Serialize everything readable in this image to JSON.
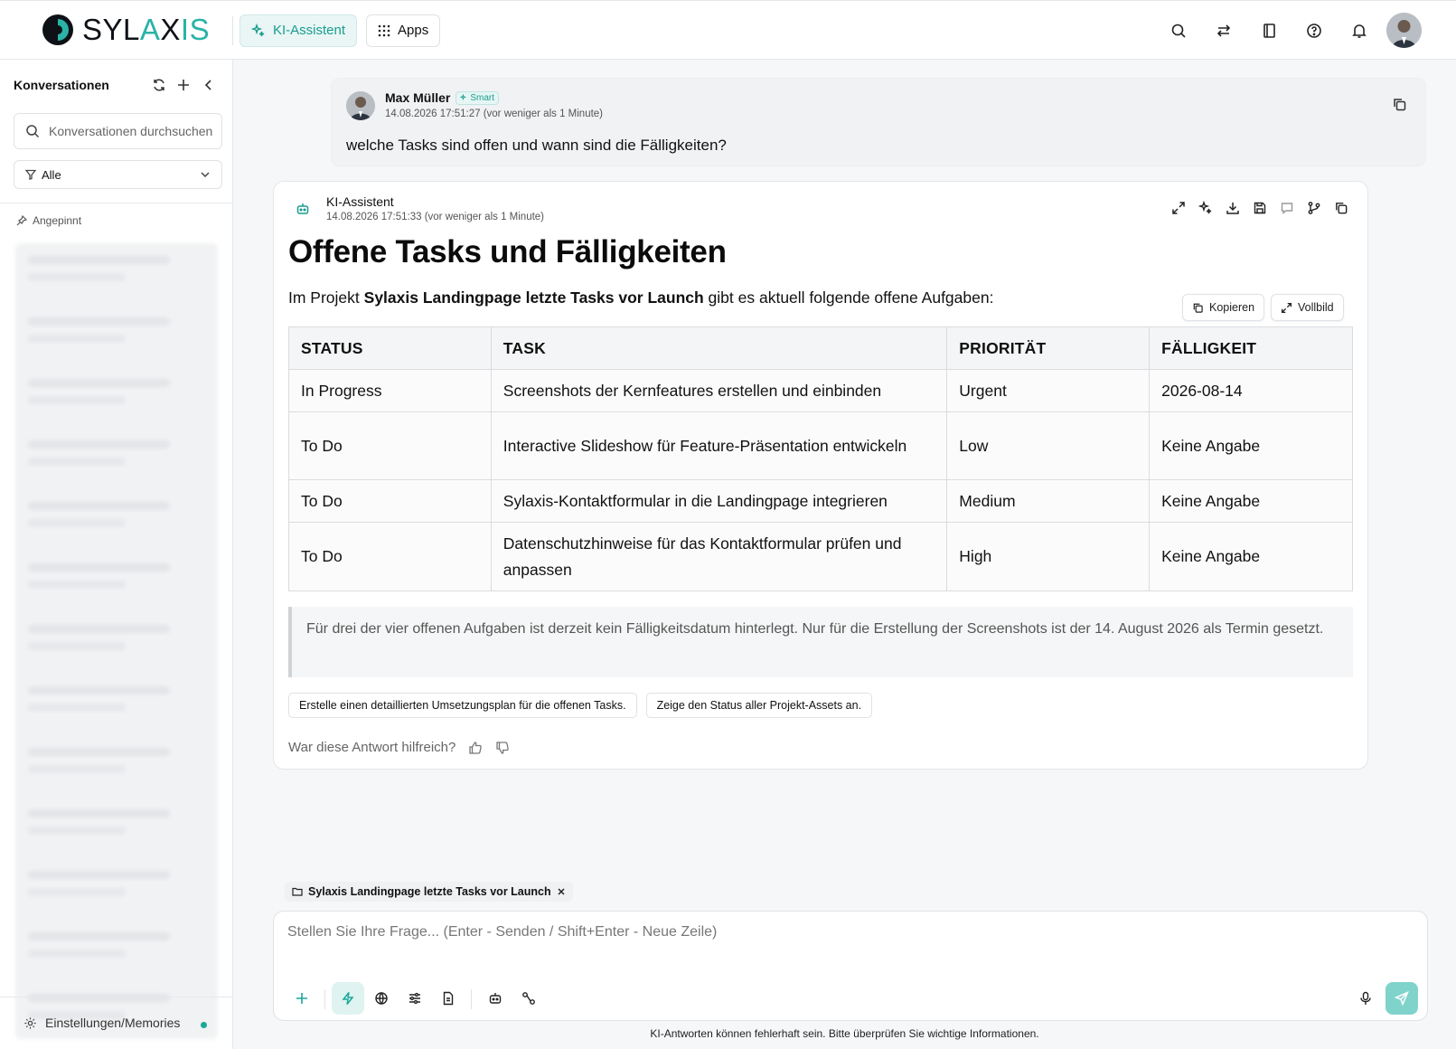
{
  "header": {
    "logo": {
      "part1": "SYL",
      "part2": "A",
      "part3": "X",
      "part4": "IS"
    },
    "nav": [
      {
        "label": "KI-Assistent",
        "icon": "sparkles-icon",
        "active": true
      },
      {
        "label": "Apps",
        "icon": "grid-icon",
        "active": false
      }
    ],
    "icons": [
      "search-icon",
      "swap-icon",
      "book-icon",
      "help-icon",
      "bell-icon",
      "user-avatar"
    ]
  },
  "sidebar": {
    "title": "Konversationen",
    "search_placeholder": "Konversationen durchsuchen",
    "filter_value": "Alle",
    "pinned_label": "Angepinnt",
    "settings_label": "Einstellungen/Memories"
  },
  "user_message": {
    "name": "Max Müller",
    "badge": "Smart",
    "timestamp": "14.08.2026 17:51:27 (vor weniger als 1 Minute)",
    "text": "welche Tasks sind offen und wann sind die Fälligkeiten?"
  },
  "assistant": {
    "name": "KI-Assistent",
    "timestamp": "14.08.2026 17:51:33 (vor weniger als 1 Minute)",
    "title": "Offene Tasks und Fälligkeiten",
    "intro_pre": "Im Projekt ",
    "intro_bold": "Sylaxis Landingpage letzte Tasks vor Launch",
    "intro_post": " gibt es aktuell folgende offene Aufgaben:",
    "copy_label": "Kopieren",
    "fullscreen_label": "Vollbild",
    "table": {
      "headers": [
        "STATUS",
        "TASK",
        "PRIORITÄT",
        "FÄLLIGKEIT"
      ],
      "rows": [
        [
          "In Progress",
          "Screenshots der Kernfeatures erstellen und einbinden",
          "Urgent",
          "2026-08-14"
        ],
        [
          "To Do",
          "Interactive Slideshow für Feature-Präsentation entwickeln",
          "Low",
          "Keine Angabe"
        ],
        [
          "To Do",
          "Sylaxis-Kontaktformular in die Landingpage integrieren",
          "Medium",
          "Keine Angabe"
        ],
        [
          "To Do",
          "Datenschutzhinweise für das Kontaktformular prüfen und anpassen",
          "High",
          "Keine Angabe"
        ]
      ]
    },
    "note": "Für drei der vier offenen Aufgaben ist derzeit kein Fälligkeitsdatum hinterlegt. Nur für die Erstellung der Screenshots ist der 14. August 2026 als Termin gesetzt.",
    "suggestions": [
      "Erstelle einen detaillierten Umsetzungsplan für die offenen Tasks.",
      "Zeige den Status aller Projekt-Assets an."
    ],
    "feedback_label": "War diese Antwort hilfreich?"
  },
  "composer": {
    "context_chip": "Sylaxis Landingpage letzte Tasks vor Launch",
    "placeholder": "Stellen Sie Ihre Frage... (Enter - Senden / Shift+Enter - Neue Zeile)",
    "disclaimer": "KI-Antworten können fehlerhaft sein. Bitte überprüfen Sie wichtige Informationen."
  },
  "colors": {
    "accent": "#1aa89a",
    "accent_light": "#dff3f1",
    "send": "#7fd3cb"
  }
}
